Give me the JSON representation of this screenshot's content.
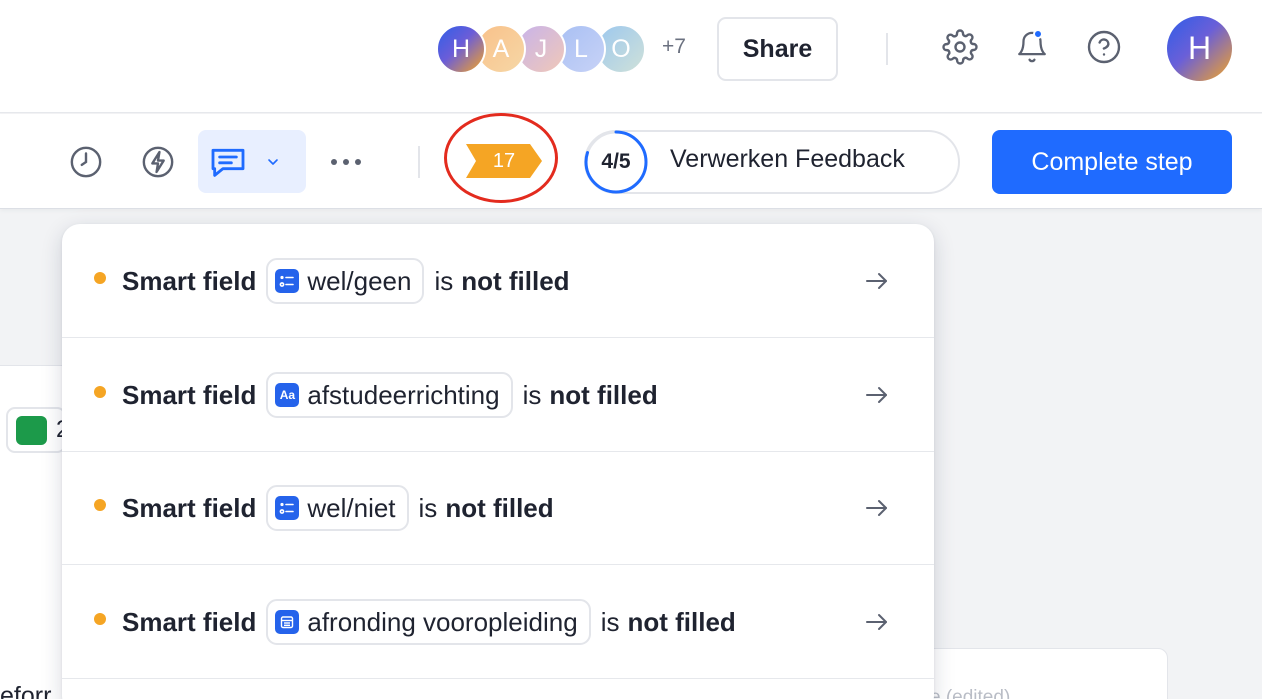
{
  "header": {
    "collaborators": [
      {
        "initial": "H"
      },
      {
        "initial": "A"
      },
      {
        "initial": "J"
      },
      {
        "initial": "L"
      },
      {
        "initial": "O"
      }
    ],
    "more_count": "+7",
    "share_label": "Share",
    "user_initial": "H"
  },
  "toolbar": {
    "issue_count": "17",
    "step_progress": "4/5",
    "step_done": 4,
    "step_total": 5,
    "step_title": "Verwerken Feedback",
    "complete_label": "Complete step"
  },
  "issues": [
    {
      "prefix": "Smart field",
      "field": "wel/geen",
      "field_icon": "list-icon",
      "middle": "is",
      "status": "not filled"
    },
    {
      "prefix": "Smart field",
      "field": "afstudeerrichting",
      "field_icon": "text-icon",
      "middle": "is",
      "status": "not filled"
    },
    {
      "prefix": "Smart field",
      "field": "wel/niet",
      "field_icon": "list-icon",
      "middle": "is",
      "status": "not filled"
    },
    {
      "prefix": "Smart field",
      "field": "afronding vooropleiding",
      "field_icon": "date-icon",
      "middle": "is",
      "status": "not filled"
    }
  ],
  "field_icon_text": "Aa",
  "background": {
    "chip_text": "2",
    "text_fragment": "eforr",
    "faint_text": "e (edited)"
  },
  "colors": {
    "accent": "#1f6bff",
    "warning": "#f5a524",
    "annotation_ring": "#e32b1e"
  }
}
